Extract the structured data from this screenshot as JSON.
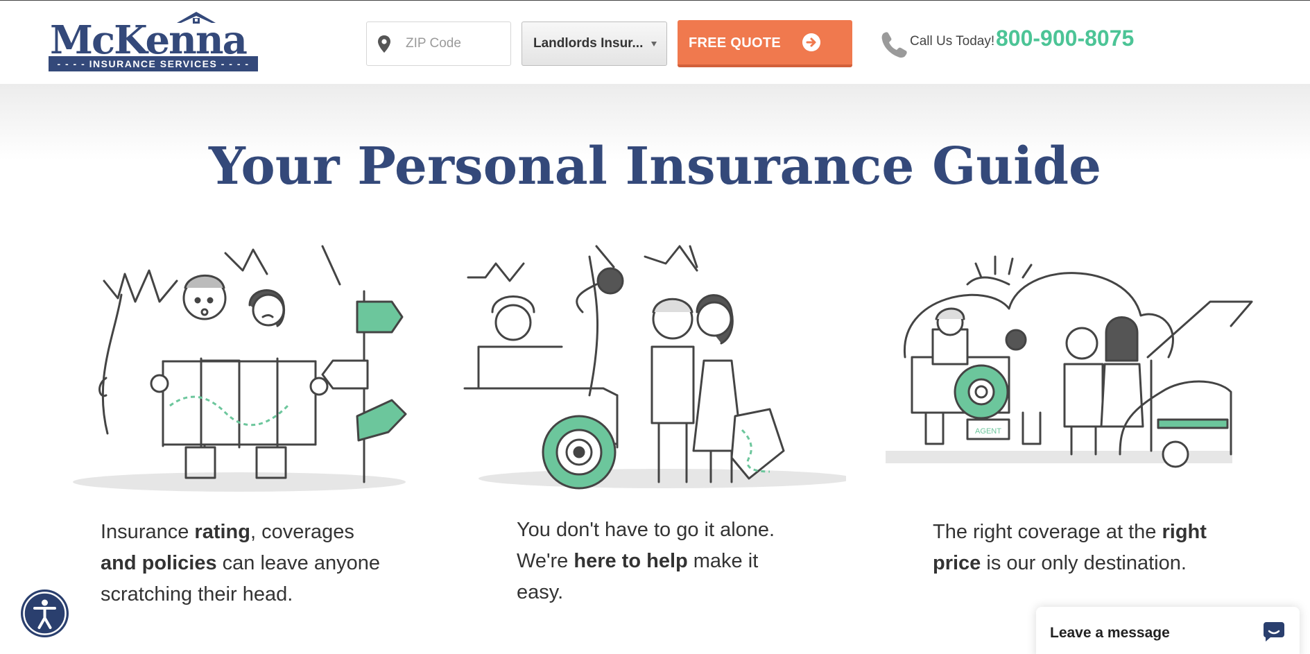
{
  "header": {
    "logo": {
      "name": "McKenna",
      "tagline": "INSURANCE SERVICES"
    },
    "zip": {
      "placeholder": "ZIP Code",
      "value": ""
    },
    "insurance_select": {
      "selected": "Landlords Insur..."
    },
    "quote_button": {
      "label": "FREE QUOTE"
    },
    "contact": {
      "call_label": "Call Us Today!",
      "phone": "800-900-8075"
    }
  },
  "main": {
    "title": "Your Personal Insurance Guide",
    "columns": [
      {
        "parts": [
          "Insurance ",
          "rating",
          ", coverages",
          "and policies",
          " can leave anyone",
          "scratching their head."
        ]
      },
      {
        "parts": [
          "You don't have to go it alone.",
          "We're ",
          "here to help",
          " make it",
          "easy."
        ]
      },
      {
        "parts": [
          "The right coverage at the ",
          "right",
          "price",
          " is our only destination."
        ]
      }
    ],
    "illustration_labels": {
      "plate": "AGENT"
    }
  },
  "chat": {
    "label": "Leave a message"
  },
  "colors": {
    "brand_blue": "#34497a",
    "accent_green": "#4cc496",
    "illus_green": "#6cc69c",
    "cta_orange": "#f0794e"
  },
  "icons": [
    "location-pin-icon",
    "chevron-down-icon",
    "arrow-right-circle-icon",
    "phone-icon",
    "accessibility-icon",
    "chat-bubble-icon"
  ]
}
